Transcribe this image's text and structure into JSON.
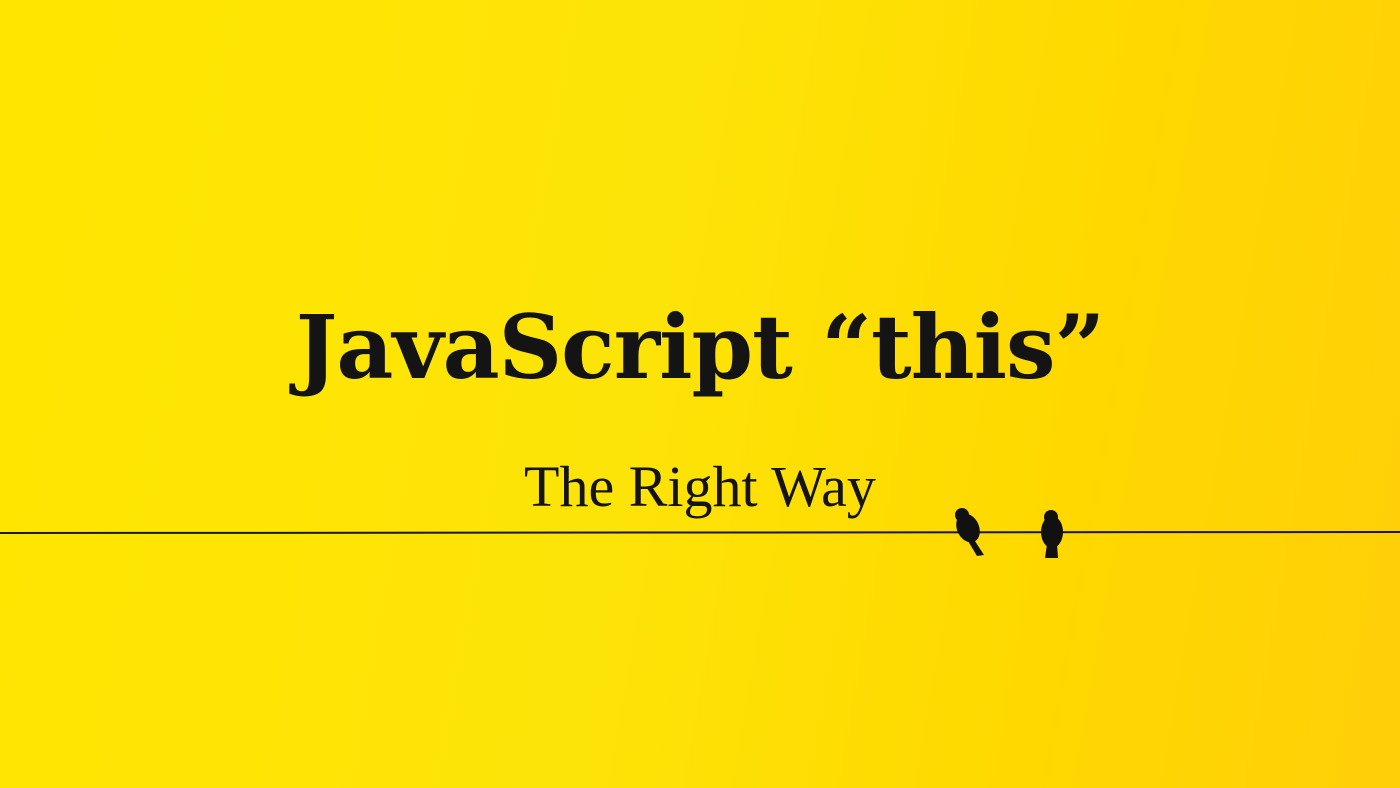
{
  "title": "JavaScript “this”",
  "subtitle": "The Right Way",
  "colors": {
    "background": "#ffe600",
    "text": "#141414",
    "wire": "#1a1a1a"
  }
}
